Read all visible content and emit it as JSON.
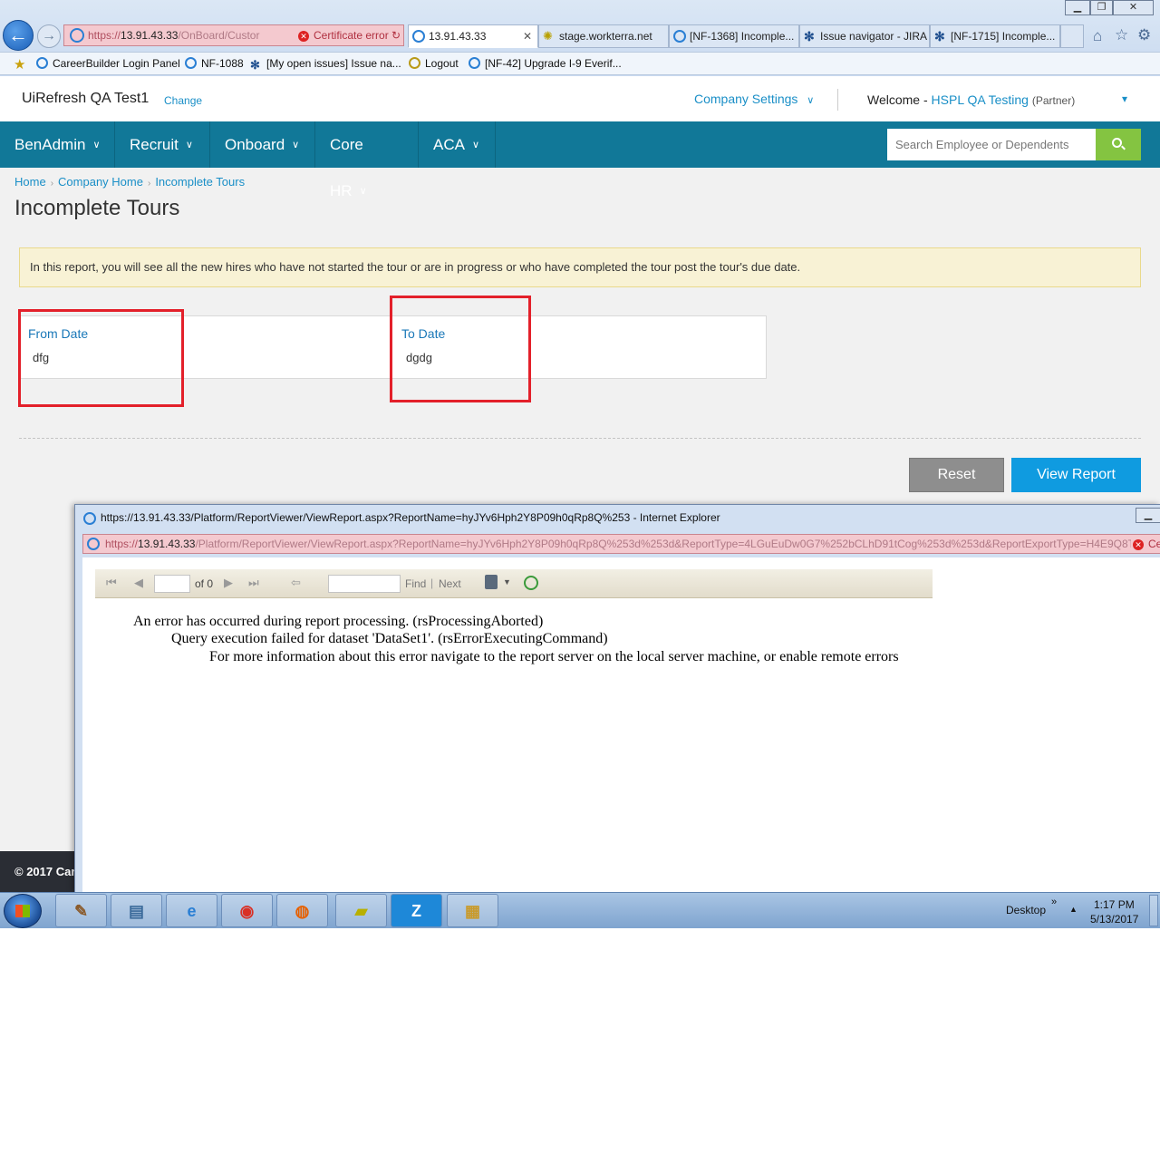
{
  "browser": {
    "address": {
      "scheme": "https://",
      "host": "13.91.43.33",
      "path": "/OnBoard/Custor",
      "cert_error": "Certificate error"
    },
    "tabs": [
      {
        "label": "13.91.43.33",
        "icon": "ie-icon",
        "active": true
      },
      {
        "label": "stage.workterra.net",
        "icon": "star-icon"
      },
      {
        "label": "[NF-1368] Incomple...",
        "icon": "ie-icon"
      },
      {
        "label": "Issue navigator - JIRA",
        "icon": "jira-icon"
      },
      {
        "label": "[NF-1715] Incomple...",
        "icon": "jira-icon"
      }
    ],
    "favorites": [
      {
        "label": "CareerBuilder Login Panel",
        "icon": "ie-icon"
      },
      {
        "label": "NF-1088",
        "icon": "ie-icon"
      },
      {
        "label": "[My open issues] Issue na...",
        "icon": "jira-icon"
      },
      {
        "label": "Logout",
        "icon": "logout-icon"
      },
      {
        "label": "[NF-42] Upgrade I-9 Everif...",
        "icon": "ie-icon"
      }
    ],
    "tab_close": "✕"
  },
  "header": {
    "company_name": "UiRefresh QA Test1",
    "change_label": "Change",
    "company_settings": "Company Settings",
    "welcome_prefix": "Welcome -",
    "user_name": "HSPL QA Testing",
    "user_role": "(Partner)"
  },
  "nav": {
    "items": [
      {
        "label": "BenAdmin"
      },
      {
        "label": "Recruit"
      },
      {
        "label": "Onboard"
      },
      {
        "label": "Core HR"
      },
      {
        "label": "ACA"
      }
    ],
    "search_placeholder": "Search Employee or Dependents"
  },
  "breadcrumb": [
    "Home",
    "Company Home",
    "Incomplete Tours"
  ],
  "page": {
    "title": "Incomplete Tours",
    "info": "In this report, you will see all the new hires who have not started the tour or are in progress or who have completed the tour post the tour's due date.",
    "from_label": "From Date",
    "from_value": "dfg",
    "to_label": "To Date",
    "to_value": "dgdg",
    "reset_label": "Reset",
    "view_label": "View Report",
    "footer": "© 2017 Car"
  },
  "popup": {
    "title": "https://13.91.43.33/Platform/ReportViewer/ViewReport.aspx?ReportName=hyJYv6Hph2Y8P09h0qRp8Q%253 - Internet Explorer",
    "addr_scheme": "https://",
    "addr_host": "13.91.43.33",
    "addr_path": "/Platform/ReportViewer/ViewReport.aspx?ReportName=hyJYv6Hph2Y8P09h0qRp8Q%253d%253d&ReportType=4LGuEuDw0G7%252bCLhD91tCog%253d%253d&ReportExportType=H4E9Q8TJYkc",
    "cert_error": "Ce",
    "toolbar": {
      "of_label": "of 0",
      "find_label": "Find",
      "separator": "|",
      "next_label": "Next"
    },
    "errors": [
      "An error has occurred during report processing. (rsProcessingAborted)",
      "Query execution failed for dataset 'DataSet1'. (rsErrorExecutingCommand)",
      "For more information about this error navigate to the report server on the local server machine, or enable remote errors"
    ]
  },
  "taskbar": {
    "desktop_label": "Desktop",
    "time": "1:17 PM",
    "date": "5/13/2017",
    "apps": [
      "paint-icon",
      "notepad-icon",
      "ie-icon",
      "chrome-icon",
      "firefox-icon",
      "stickynotes-icon",
      "z-app-icon",
      "explorer-icon"
    ],
    "z_label": "Z"
  },
  "colors": {
    "nav_bg": "#117898",
    "accent": "#1a8fc7",
    "view_button": "#0f9be0",
    "search_button": "#84c441",
    "highlight_box": "#e3202a"
  }
}
